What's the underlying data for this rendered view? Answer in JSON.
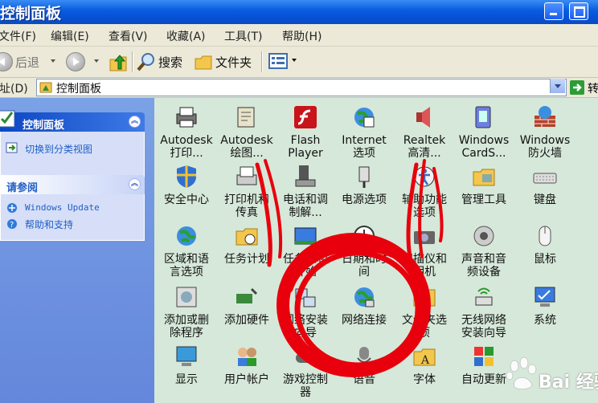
{
  "window": {
    "title": "控制面板"
  },
  "menubar": [
    "文件(F)",
    "编辑(E)",
    "查看(V)",
    "收藏(A)",
    "工具(T)",
    "帮助(H)"
  ],
  "toolbar": {
    "back_label": "后退",
    "search_label": "搜索",
    "folders_label": "文件夹"
  },
  "address": {
    "label": "址(D)",
    "value": "控制面板",
    "go_label": "转"
  },
  "sidebar": {
    "control_panel": {
      "title": "控制面板",
      "link": "切换到分类视图"
    },
    "see_also": {
      "title": "请参阅",
      "links": [
        "Windows Update",
        "帮助和支持"
      ]
    }
  },
  "items": [
    {
      "label": "Autodesk\n打印...",
      "icon": "printer-icon"
    },
    {
      "label": "Autodesk\n绘图...",
      "icon": "plotter-icon"
    },
    {
      "label": "Flash\nPlayer",
      "icon": "flash-icon"
    },
    {
      "label": "Internet\n选项",
      "icon": "internet-options-icon"
    },
    {
      "label": "Realtek\n高清...",
      "icon": "speaker-icon"
    },
    {
      "label": "Windows\nCardS...",
      "icon": "cardspace-icon"
    },
    {
      "label": "Windows\n防火墙",
      "icon": "firewall-icon"
    },
    {
      "label": "安全中心",
      "icon": "security-shield-icon"
    },
    {
      "label": "打印机和\n传真",
      "icon": "printer-fax-icon"
    },
    {
      "label": "电话和调\n制解...",
      "icon": "phone-modem-icon"
    },
    {
      "label": "电源选项",
      "icon": "power-icon"
    },
    {
      "label": "辅助功能\n选项",
      "icon": "accessibility-icon"
    },
    {
      "label": "管理工具",
      "icon": "admin-tools-icon"
    },
    {
      "label": "键盘",
      "icon": "keyboard-icon"
    },
    {
      "label": "区域和语\n言选项",
      "icon": "globe-icon"
    },
    {
      "label": "任务计划",
      "icon": "scheduled-tasks-icon"
    },
    {
      "label": "任务栏和\n开始",
      "icon": "taskbar-icon"
    },
    {
      "label": "日期和时\n间",
      "icon": "clock-icon"
    },
    {
      "label": "扫描仪和\n相机",
      "icon": "camera-icon"
    },
    {
      "label": "声音和音\n频设备",
      "icon": "sound-icon"
    },
    {
      "label": "鼠标",
      "icon": "mouse-icon"
    },
    {
      "label": "添加或删\n除程序",
      "icon": "add-remove-icon"
    },
    {
      "label": "添加硬件",
      "icon": "add-hardware-icon"
    },
    {
      "label": "网络安装\n向导",
      "icon": "network-setup-icon"
    },
    {
      "label": "网络连接",
      "icon": "network-connections-icon"
    },
    {
      "label": "文件夹选\n项",
      "icon": "folder-options-icon"
    },
    {
      "label": "无线网络\n安装向导",
      "icon": "wireless-icon"
    },
    {
      "label": "系统",
      "icon": "system-icon"
    },
    {
      "label": "显示",
      "icon": "display-icon"
    },
    {
      "label": "用户帐户",
      "icon": "user-accounts-icon"
    },
    {
      "label": "游戏控制\n器",
      "icon": "game-controller-icon"
    },
    {
      "label": "语音",
      "icon": "speech-icon"
    },
    {
      "label": "字体",
      "icon": "fonts-icon"
    },
    {
      "label": "自动更新",
      "icon": "auto-update-icon"
    }
  ],
  "watermark": {
    "text": "Bai  经验"
  },
  "colors": {
    "titlebar": "#0a5fe0",
    "sidebar": "#6e93df",
    "content_bg": "#d6e8d9",
    "annotation": "#e8000c"
  }
}
